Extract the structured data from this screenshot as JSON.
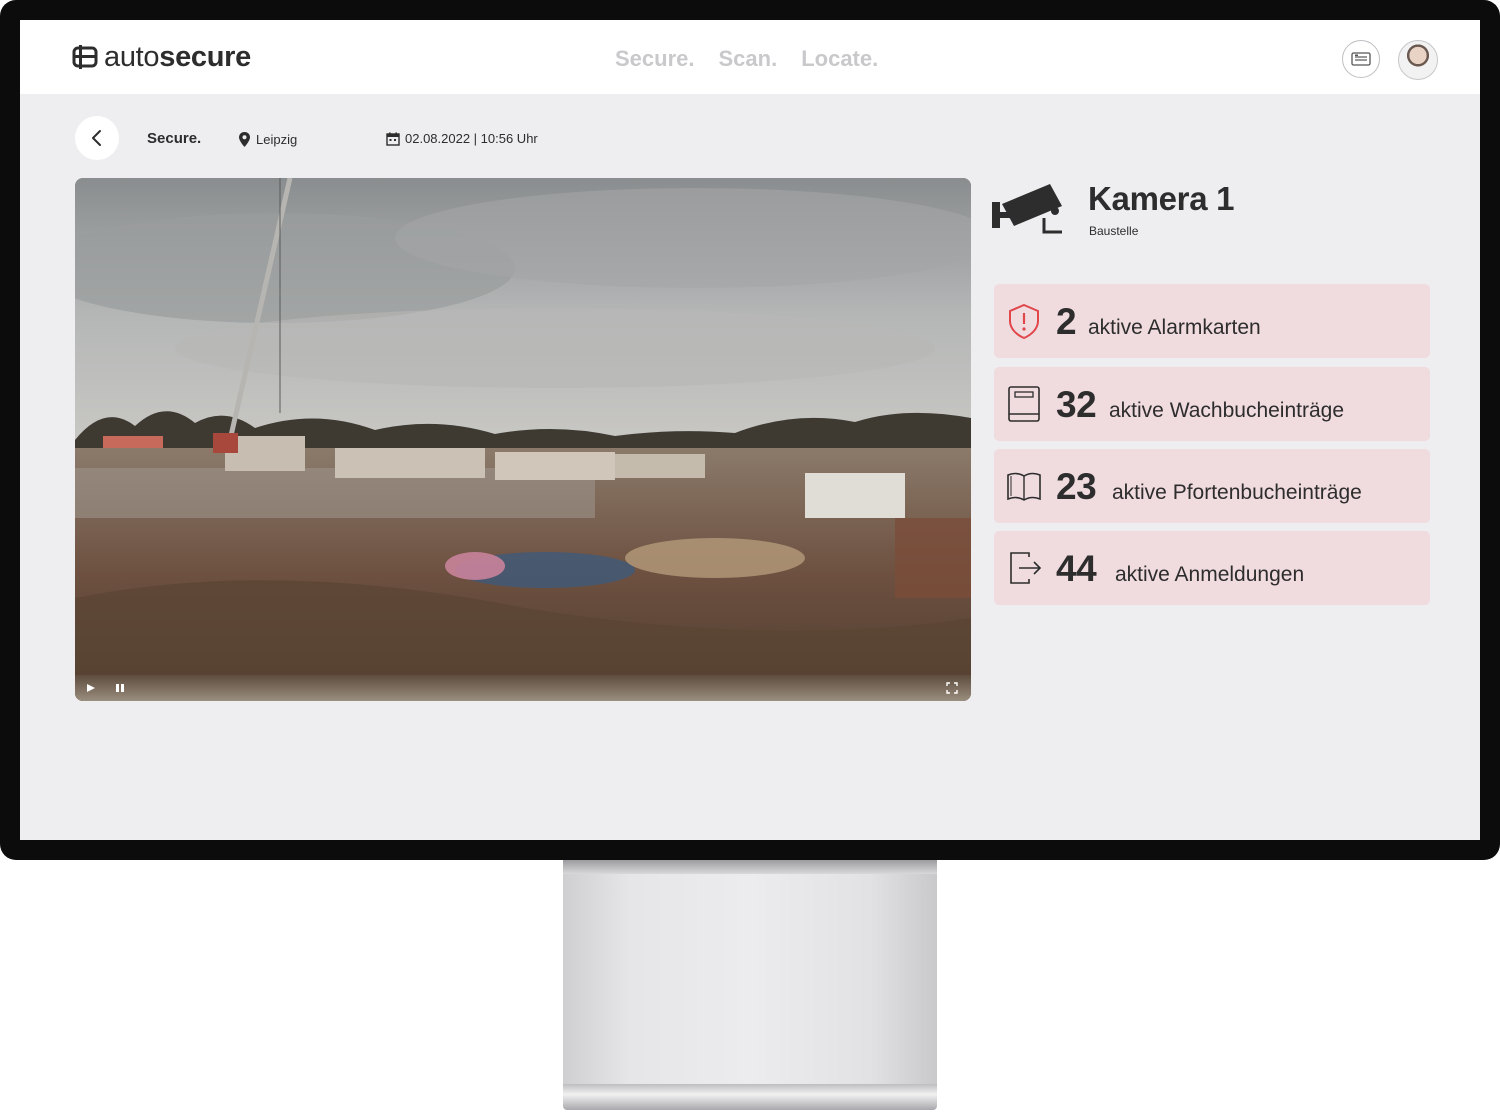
{
  "app": {
    "brand_light": "auto",
    "brand_bold": "secure"
  },
  "nav": {
    "items": [
      "Secure.",
      "Scan.",
      "Locate."
    ]
  },
  "breadcrumb": {
    "title": "Secure.",
    "location": "Leipzig",
    "datetime": "02.08.2022 | 10:56 Uhr"
  },
  "camera": {
    "title": "Kamera 1",
    "subtitle": "Baustelle"
  },
  "stats": [
    {
      "value": "2",
      "label": "aktive Alarmkarten",
      "icon": "shield-alert-icon"
    },
    {
      "value": "32",
      "label": "aktive Wachbucheinträge",
      "icon": "book-icon"
    },
    {
      "value": "23",
      "label": "aktive Pfortenbucheinträge",
      "icon": "open-book-icon"
    },
    {
      "value": "44",
      "label": "aktive Anmeldungen",
      "icon": "login-icon"
    }
  ],
  "colors": {
    "card_background": "#f0dbdf",
    "alert_red": "#e0464a",
    "text_dark": "#2d2d2d",
    "nav_inactive": "#c9c9cc",
    "screen_background": "#eeedf0"
  }
}
